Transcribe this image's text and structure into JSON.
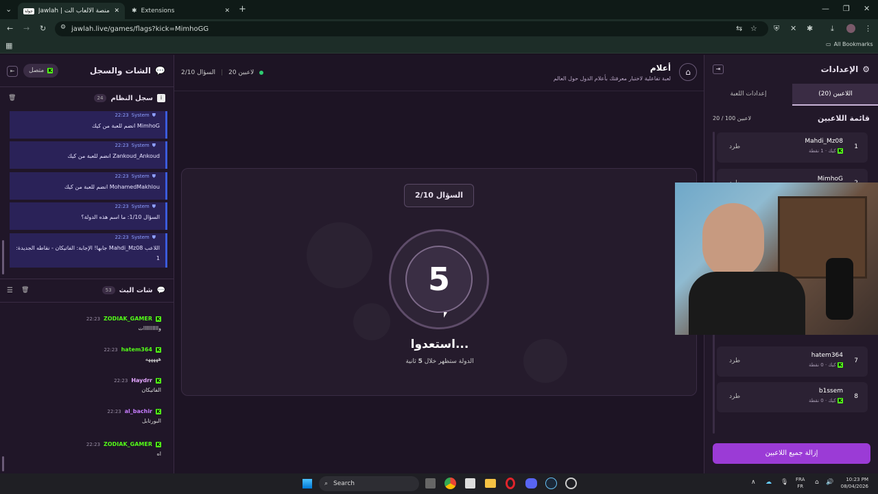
{
  "browser": {
    "tabs": [
      {
        "label": "Jawlah | جولة - منصة الألعاب الت...",
        "badge": "جولة"
      },
      {
        "label": "Extensions"
      }
    ],
    "url": "jawlah.live/games/flags?kick=MimhoGG",
    "all_bookmarks": "All Bookmarks"
  },
  "left": {
    "title": "الشات والسجل",
    "status": "متصل",
    "system_log": {
      "title": "سجل النظام",
      "count": "24",
      "messages": [
        {
          "sender": "System",
          "time": "22:23",
          "text": "MimhoG انضم للعبة من كيك"
        },
        {
          "sender": "System",
          "time": "22:23",
          "text": "Zankoud_Ankoud انضم للعبة من كيك"
        },
        {
          "sender": "System",
          "time": "22:23",
          "text": "MohamedMakhlou انضم للعبة من كيك"
        },
        {
          "sender": "System",
          "time": "22:23",
          "text": "السؤال 1/10: ما اسم هذه الدولة؟"
        },
        {
          "sender": "System",
          "time": "22:23",
          "text": "اللاعب Mahdi_Mz08 جابها! الإجابة: الفاتيكان - نقاطه الجديدة: 1"
        }
      ]
    },
    "stream_chat": {
      "title": "شات البث",
      "count": "53",
      "messages": [
        {
          "user": "ZODIAK_GAMER",
          "color": "#53fc18",
          "time": "22:23",
          "text": "واااااااااات"
        },
        {
          "user": "hatem364",
          "color": "#53fc18",
          "time": "22:23",
          "text": "هههههه"
        },
        {
          "user": "Haydrr",
          "color": "#e3a6ff",
          "time": "22:23",
          "text": "الفاتيكان"
        },
        {
          "user": "al_bachir",
          "color": "#c77dff",
          "time": "22:23",
          "text": "البورتابل"
        },
        {
          "user": "ZODIAK_GAMER",
          "color": "#53fc18",
          "time": "22:23",
          "text": "اه"
        }
      ]
    }
  },
  "center": {
    "players_count": "20 لاعبين",
    "question_counter": "السؤال 2/10",
    "game_title": "أعلام",
    "game_subtitle": "لعبة تفاعلية لاختبار معرفتك بأعلام الدول حول العالم",
    "question_badge": "السؤال 2/10",
    "countdown": "5",
    "ready_text": "استعدوا...",
    "hint_prefix": "الدولة ستظهر خلال",
    "hint_seconds": "5",
    "hint_suffix": "ثانية"
  },
  "right": {
    "title": "الإعدادات",
    "tabs": {
      "players": "اللاعبين (20)",
      "settings": "إعدادات اللعبة"
    },
    "list_title": "قائمة اللاعبين",
    "list_count": "20 / 100 لاعبين",
    "players": [
      {
        "rank": "1",
        "name": "Mahdi_Mz08",
        "platform": "كيك",
        "points": "1 نقطة",
        "kick": "طرد"
      },
      {
        "rank": "2",
        "name": "MimhoG",
        "platform": "",
        "points": "",
        "kick": "طرد"
      },
      {
        "rank": "7",
        "name": "hatem364",
        "platform": "كيك",
        "points": "0 نقطة",
        "kick": "طرد"
      },
      {
        "rank": "8",
        "name": "b1ssem",
        "platform": "كيك",
        "points": "0 نقطة",
        "kick": "طرد"
      }
    ],
    "remove_all": "إزالة جميع اللاعبين"
  },
  "taskbar": {
    "search": "Search",
    "lang_top": "FRA",
    "lang_bottom": "FR",
    "time": "10:23 PM",
    "date": "08/04/2026"
  },
  "colors": {
    "accent": "#9b3bd6",
    "kick_green": "#53fc18",
    "system_msg_bg": "#2a2258"
  }
}
